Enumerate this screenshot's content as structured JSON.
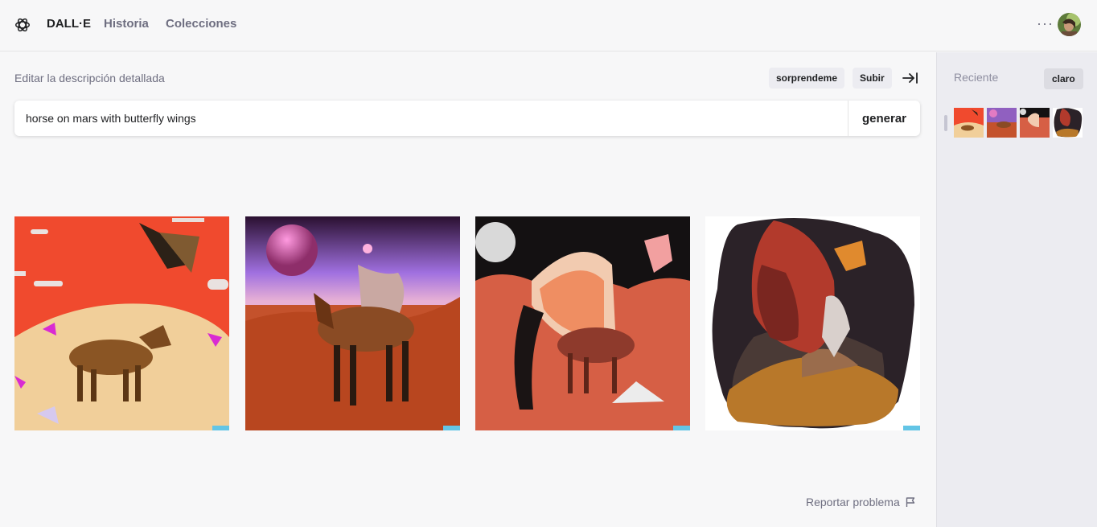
{
  "header": {
    "brand": "DALL·E",
    "nav": [
      "Historia",
      "Colecciones"
    ],
    "more_icon": "more-horizontal-icon"
  },
  "editor": {
    "label": "Editar la descripción detallada",
    "surprise_label": "sorprendeme",
    "upload_label": "Subir",
    "prompt_value": "horse on mars with butterfly wings",
    "generate_label": "generar"
  },
  "results": {
    "images": [
      "horse-desert-red-sky",
      "horse-butterfly-wings-purple-sky",
      "horse-butterfly-illustration",
      "butterfly-horse-blob"
    ]
  },
  "footer": {
    "report_label": "Reportar problema"
  },
  "sidebar": {
    "recent_label": "Reciente",
    "theme_label": "claro"
  },
  "colors": {
    "background": "#f7f7f8",
    "sidebar": "#ececf1",
    "chip": "#ececf1",
    "text_muted": "#6e6e80"
  }
}
